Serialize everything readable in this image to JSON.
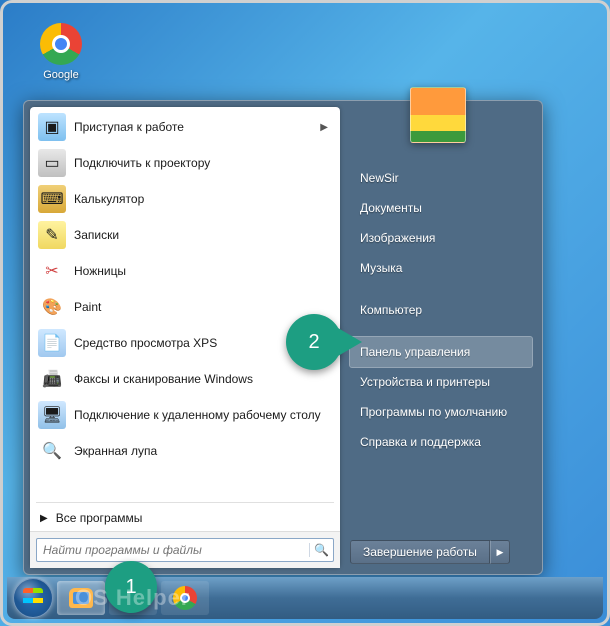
{
  "desktop": {
    "chrome_label": "Google"
  },
  "start": {
    "programs": [
      {
        "label": "Приступая к работе",
        "icon": "ic-gs",
        "glyph": "▣",
        "submenu": true
      },
      {
        "label": "Подключить к проектору",
        "icon": "ic-proj",
        "glyph": "▭"
      },
      {
        "label": "Калькулятор",
        "icon": "ic-calc",
        "glyph": "⌨"
      },
      {
        "label": "Записки",
        "icon": "ic-notes",
        "glyph": "✎"
      },
      {
        "label": "Ножницы",
        "icon": "ic-snip",
        "glyph": "✂"
      },
      {
        "label": "Paint",
        "icon": "ic-paint",
        "glyph": "🎨"
      },
      {
        "label": "Средство просмотра XPS",
        "icon": "ic-xps",
        "glyph": "📄"
      },
      {
        "label": "Факсы и сканирование Windows",
        "icon": "ic-fax",
        "glyph": "📠"
      },
      {
        "label": "Подключение к удаленному рабочему столу",
        "icon": "ic-rdp",
        "glyph": "🖥"
      },
      {
        "label": "Экранная лупа",
        "icon": "ic-mag",
        "glyph": "🔍"
      }
    ],
    "all_programs": "Все программы",
    "search_placeholder": "Найти программы и файлы",
    "right": {
      "username": "NewSir",
      "links": [
        "Документы",
        "Изображения",
        "Музыка",
        "Компьютер",
        "Панель управления",
        "Устройства и принтеры",
        "Программы по умолчанию",
        "Справка и поддержка"
      ],
      "highlight_index": 4
    },
    "shutdown": "Завершение работы"
  },
  "callouts": {
    "one": "1",
    "two": "2"
  },
  "watermark": "OS Helper"
}
